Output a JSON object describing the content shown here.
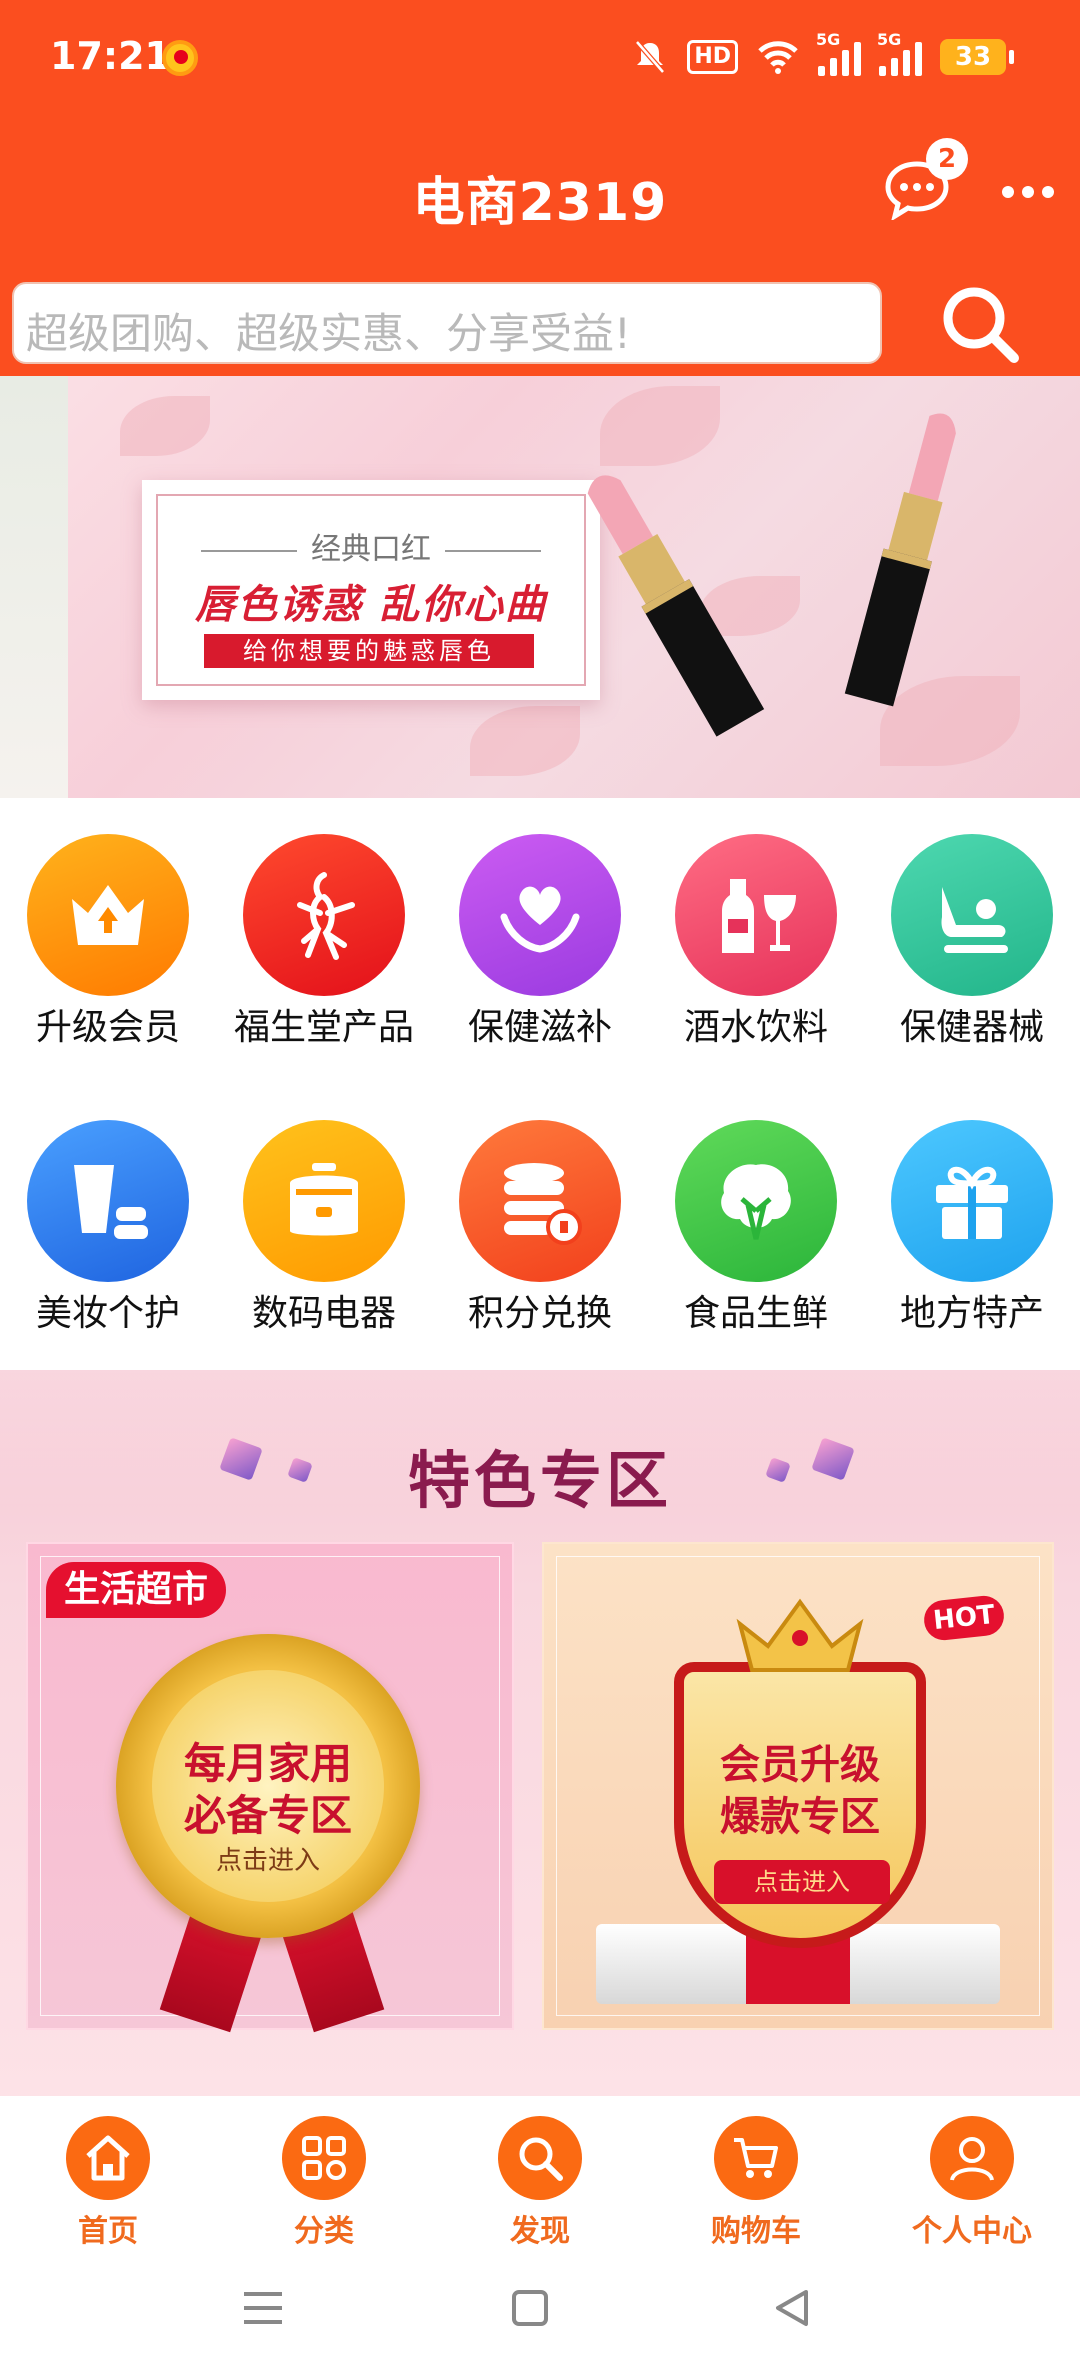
{
  "status": {
    "time": "17:21",
    "battery": "33",
    "hd_label": "HD",
    "net1": "5G",
    "net2": "5G"
  },
  "header": {
    "title": "电商2319",
    "message_count": "2"
  },
  "search": {
    "placeholder": "超级团购、超级实惠、分享受益!"
  },
  "banner": {
    "subtitle": "经典口红",
    "headline": "唇色诱惑  乱你心曲",
    "strip": "给你想要的魅惑唇色"
  },
  "categories": [
    {
      "label": "升级会员",
      "icon": "crown-upgrade-icon",
      "color": "#ff8a00"
    },
    {
      "label": "福生堂产品",
      "icon": "ginseng-icon",
      "color": "#f2261f"
    },
    {
      "label": "保健滋补",
      "icon": "heart-hands-icon",
      "color": "#b548e8"
    },
    {
      "label": "酒水饮料",
      "icon": "wine-icon",
      "color": "#f04a6c"
    },
    {
      "label": "保健器械",
      "icon": "massage-chair-icon",
      "color": "#2fc59a"
    },
    {
      "label": "美妆个护",
      "icon": "cosmetics-icon",
      "color": "#2f7fee"
    },
    {
      "label": "数码电器",
      "icon": "rice-cooker-icon",
      "color": "#ffaa00"
    },
    {
      "label": "积分兑换",
      "icon": "coins-icon",
      "color": "#ff5a24"
    },
    {
      "label": "食品生鲜",
      "icon": "vegetable-icon",
      "color": "#3ecb4c"
    },
    {
      "label": "地方特产",
      "icon": "gift-icon",
      "color": "#2bb4f5"
    }
  ],
  "featured": {
    "title": "特色专区",
    "left": {
      "tag": "生活超市",
      "line1": "每月家用",
      "line2": "必备专区",
      "cta": "点击进入"
    },
    "right": {
      "badge": "HOT",
      "line1": "会员升级",
      "line2": "爆款专区",
      "cta": "点击进入"
    }
  },
  "nav": [
    {
      "label": "首页",
      "icon": "home-icon"
    },
    {
      "label": "分类",
      "icon": "grid-icon"
    },
    {
      "label": "发现",
      "icon": "search-icon"
    },
    {
      "label": "购物车",
      "icon": "cart-icon"
    },
    {
      "label": "个人中心",
      "icon": "user-icon"
    }
  ],
  "colors": {
    "brand": "#fb4e1f",
    "nav_accent": "#fb6a12"
  }
}
